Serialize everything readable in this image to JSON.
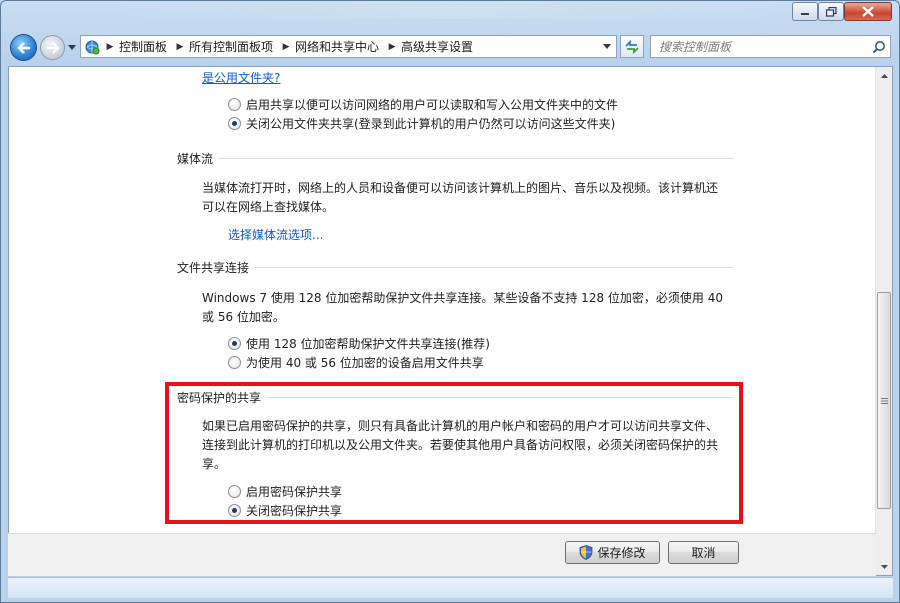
{
  "address_bar": {
    "crumbs": [
      "控制面板",
      "所有控制面板项",
      "网络和共享中心",
      "高级共享设置"
    ]
  },
  "search": {
    "placeholder": "搜索控制面板"
  },
  "public_folder": {
    "link_text": "是公用文件夹?",
    "options": [
      {
        "label": "启用共享以便可以访问网络的用户可以读取和写入公用文件夹中的文件",
        "selected": false
      },
      {
        "label": "关闭公用文件夹共享(登录到此计算机的用户仍然可以访问这些文件夹)",
        "selected": true
      }
    ]
  },
  "media_streaming": {
    "title": "媒体流",
    "desc_line1": "当媒体流打开时，网络上的人员和设备便可以访问该计算机上的图片、音乐以及视频。该计算机还",
    "desc_line2": "可以在网络上查找媒体。",
    "link_text": "选择媒体流选项..."
  },
  "file_sharing": {
    "title": "文件共享连接",
    "desc_line1": "Windows 7 使用 128 位加密帮助保护文件共享连接。某些设备不支持 128 位加密，必须使用 40",
    "desc_line2": "或 56 位加密。",
    "options": [
      {
        "label": "使用 128 位加密帮助保护文件共享连接(推荐)",
        "selected": true
      },
      {
        "label": "为使用 40 或 56 位加密的设备启用文件共享",
        "selected": false
      }
    ]
  },
  "password_sharing": {
    "title": "密码保护的共享",
    "desc_line1": "如果已启用密码保护的共享，则只有具备此计算机的用户帐户和密码的用户才可以访问共享文件、",
    "desc_line2": "连接到此计算机的打印机以及公用文件夹。若要使其他用户具备访问权限，必须关闭密码保护的共",
    "desc_line3": "享。",
    "options": [
      {
        "label": "启用密码保护共享",
        "selected": false
      },
      {
        "label": "关闭密码保护共享",
        "selected": true
      }
    ]
  },
  "footer": {
    "save_label": "保存修改",
    "cancel_label": "取消"
  },
  "colors": {
    "link": "#0b5ccf",
    "highlight": "#e8101c"
  }
}
